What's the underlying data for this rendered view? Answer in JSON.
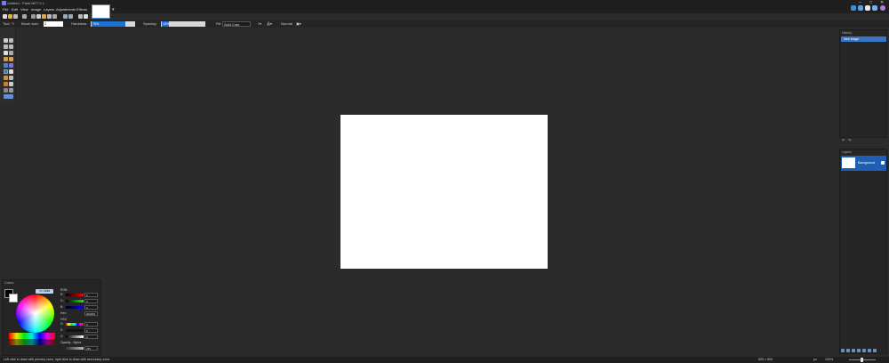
{
  "window": {
    "title": "Untitled - Paint.NET 5.1"
  },
  "menu": [
    "File",
    "Edit",
    "View",
    "Image",
    "Layers",
    "Adjustments",
    "Effects"
  ],
  "options": {
    "tool_label": "Tool:",
    "brush_size_label": "Brush size:",
    "brush_size_value": "2",
    "hardness_label": "Hardness:",
    "hardness_value": "75%",
    "spacing_label": "Spacing:",
    "spacing_value": "15%",
    "fill_label": "Fill:",
    "fill_value": "Solid Color",
    "blend_label": "Normal"
  },
  "history": {
    "title": "History",
    "items": [
      "New Image"
    ]
  },
  "layers": {
    "title": "Layers",
    "items": [
      "Background"
    ]
  },
  "colors": {
    "title": "Colors",
    "more_label": "<< Less",
    "rgb_label": "RGB",
    "r_label": "R:",
    "g_label": "G:",
    "b_label": "B:",
    "r_value": "0",
    "g_value": "0",
    "b_value": "0",
    "hex_label": "Hex:",
    "hex_value": "000000",
    "hsv_label": "HSV",
    "h_label": "H:",
    "s_label": "S:",
    "v_label": "V:",
    "h_value": "0",
    "s_value": "0",
    "v_value": "0",
    "opacity_label": "Opacity - Alpha",
    "opacity_value": "255"
  },
  "status": {
    "hint": "Left click to draw with primary color, right click to draw with secondary color.",
    "size": "800 × 600",
    "unit": "px",
    "zoom": "100%"
  },
  "colors_theme": {
    "accent": "#3a75c4",
    "selected_layer": "#1e5fb4",
    "bg": "#2b2b2b"
  }
}
